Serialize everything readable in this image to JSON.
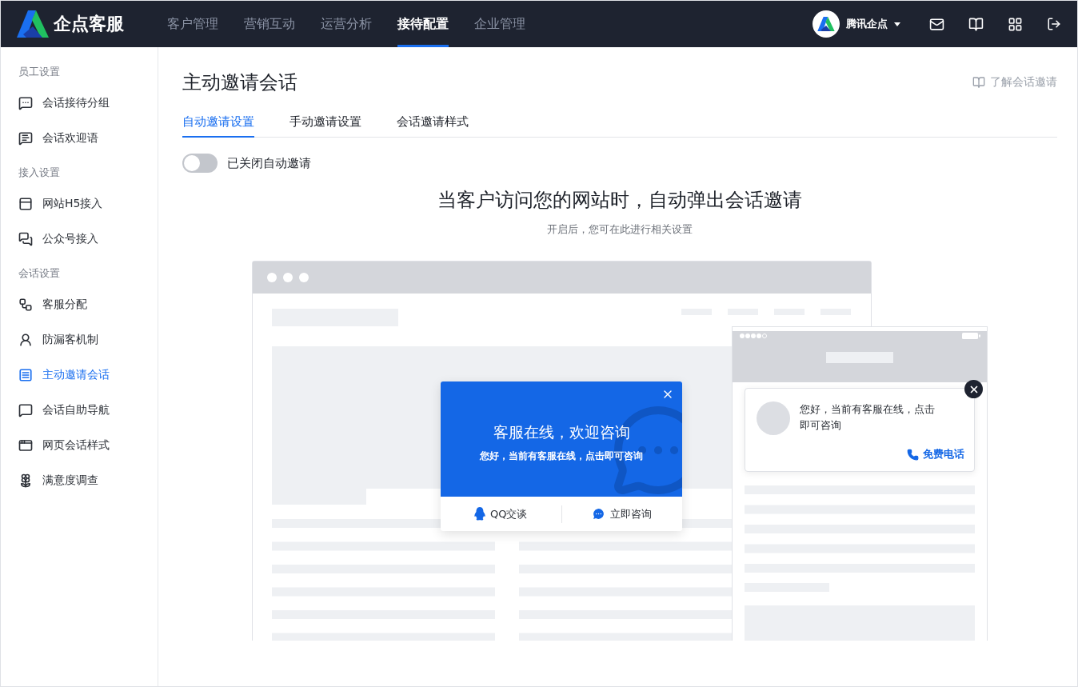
{
  "header": {
    "brand": "企点客服",
    "nav": [
      {
        "label": "客户管理",
        "selected": false
      },
      {
        "label": "营销互动",
        "selected": false
      },
      {
        "label": "运营分析",
        "selected": false
      },
      {
        "label": "接待配置",
        "selected": true
      },
      {
        "label": "企业管理",
        "selected": false
      }
    ],
    "account": "腾讯企点"
  },
  "sidebar": {
    "groups": [
      {
        "title": "员工设置",
        "items": [
          {
            "label": "会话接待分组",
            "selected": false
          },
          {
            "label": "会话欢迎语",
            "selected": false
          }
        ]
      },
      {
        "title": "接入设置",
        "items": [
          {
            "label": "网站H5接入",
            "selected": false
          },
          {
            "label": "公众号接入",
            "selected": false
          }
        ]
      },
      {
        "title": "会话设置",
        "items": [
          {
            "label": "客服分配",
            "selected": false
          },
          {
            "label": "防漏客机制",
            "selected": false
          },
          {
            "label": "主动邀请会话",
            "selected": true
          },
          {
            "label": "会话自助导航",
            "selected": false
          },
          {
            "label": "网页会话样式",
            "selected": false
          },
          {
            "label": "满意度调查",
            "selected": false
          }
        ]
      }
    ]
  },
  "page": {
    "title": "主动邀请会话",
    "help_link": "了解会话邀请",
    "tabs": [
      {
        "label": "自动邀请设置",
        "selected": true
      },
      {
        "label": "手动邀请设置",
        "selected": false
      },
      {
        "label": "会话邀请样式",
        "selected": false
      }
    ],
    "toggle": {
      "on": false,
      "label": "已关闭自动邀请"
    },
    "headline": "当客户访问您的网站时，自动弹出会话邀请",
    "subline": "开启后，您可在此进行相关设置",
    "preview": {
      "popup": {
        "title": "客服在线，欢迎咨询",
        "text": "您好，当前有客服在线，点击即可咨询",
        "actions": [
          "QQ交谈",
          "立即咨询"
        ]
      },
      "mobile_card": {
        "text": "您好，当前有客服在线，点击即可咨询",
        "action": "免费电话"
      }
    }
  }
}
